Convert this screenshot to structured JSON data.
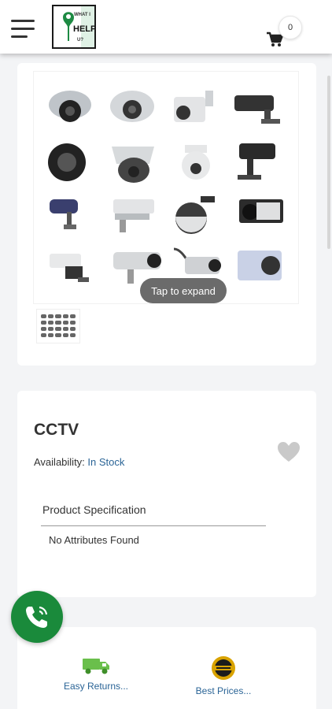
{
  "header": {
    "logo_text_top": "WHAT I",
    "logo_text_mid": "HELP",
    "logo_text_bot": "U?",
    "cart_count": "0",
    "menu_icon": "hamburger-icon",
    "cart_icon": "shopping-cart-icon"
  },
  "gallery": {
    "tap_label": "Tap to expand",
    "image_subject": "cctv-cameras-collage",
    "thumbnail_count": 1
  },
  "product": {
    "title": "CCTV",
    "availability_label": "Availability:",
    "availability_value": "In Stock",
    "wishlist_icon": "heart-icon",
    "spec_heading": "Product Specification",
    "no_attributes": "No Attributes Found"
  },
  "features": [
    {
      "label": "Easy Returns...",
      "icon": "delivery-truck-icon"
    },
    {
      "label": "Best Prices...",
      "icon": "best-price-badge-icon"
    }
  ],
  "fab": {
    "icon": "phone-call-icon"
  },
  "colors": {
    "accent_link": "#2a6496",
    "call_green": "#1a8a3b",
    "truck_green": "#6abf4b",
    "badge_gold": "#d9a300"
  }
}
